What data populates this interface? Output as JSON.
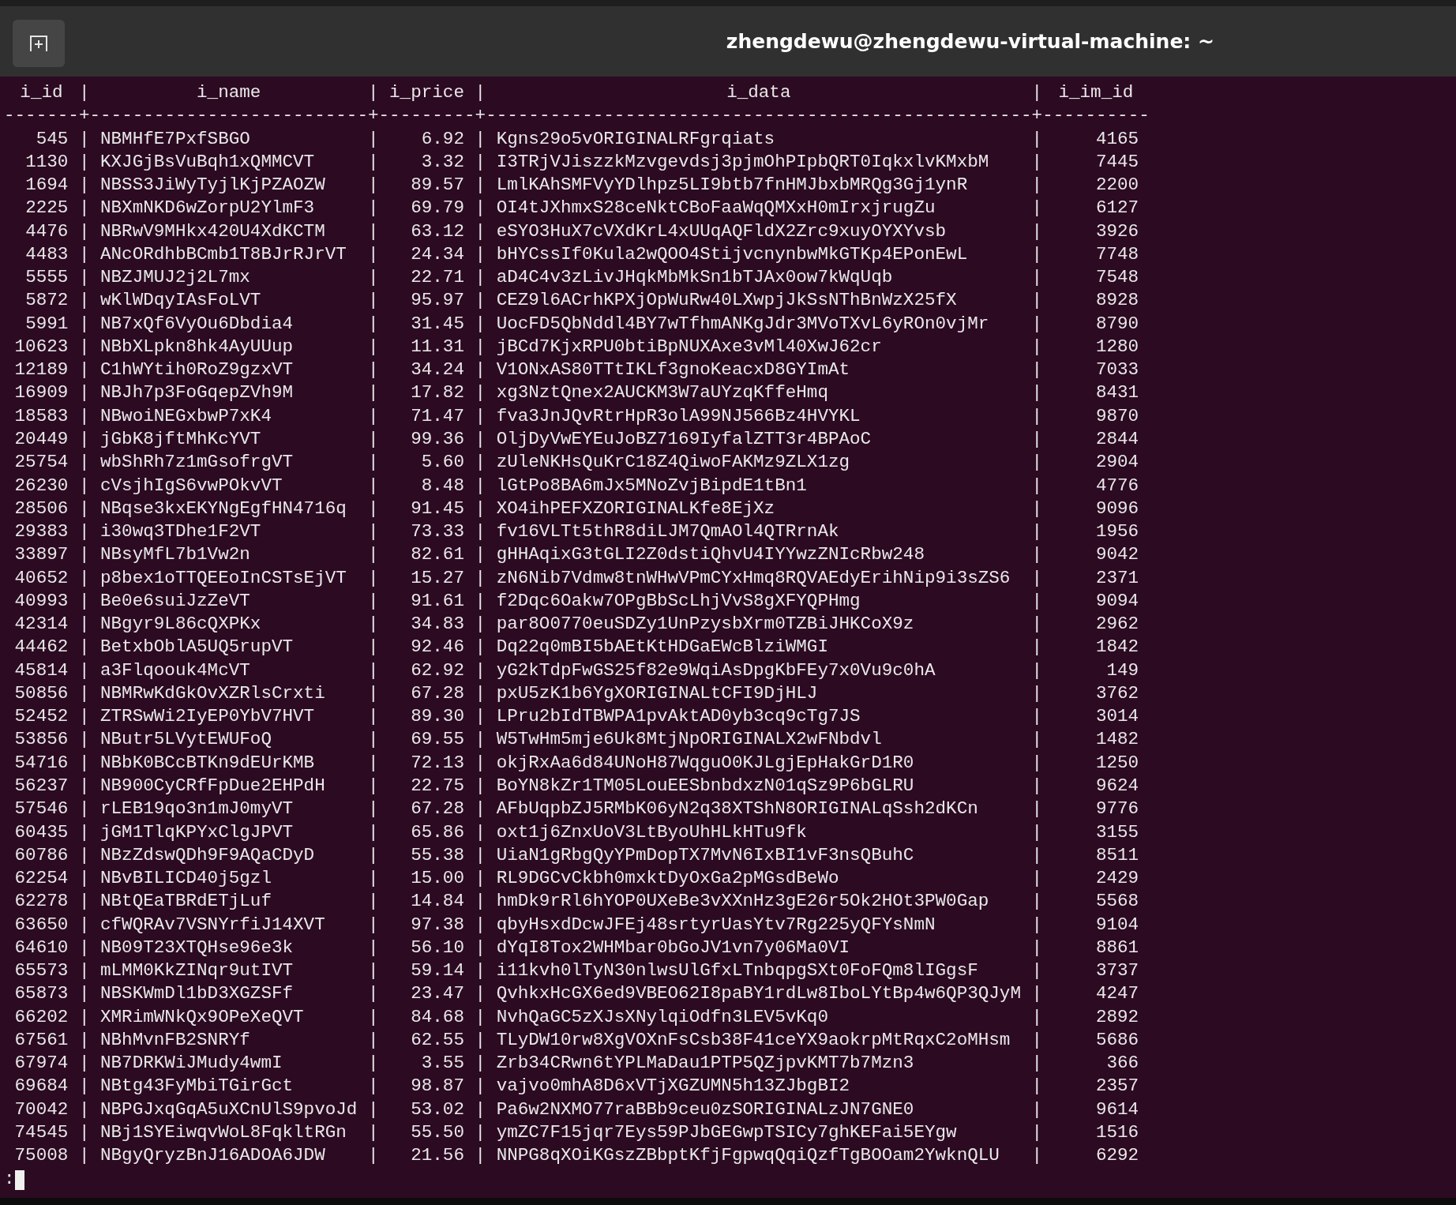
{
  "window": {
    "title": "zhengdewu@zhengdewu-virtual-machine: ~"
  },
  "table": {
    "columns": [
      "i_id",
      "i_name",
      "i_price",
      "i_data",
      "i_im_id"
    ],
    "separator": "|",
    "rule": "-------+--------------------------+---------+---------------------------------------------------+----------",
    "rows": [
      [
        "545",
        "NBMHfE7PxfSBGO",
        "6.92",
        "Kgns29o5vORIGINALRFgrqiats",
        "4165"
      ],
      [
        "1130",
        "KXJGjBsVuBqh1xQMMCVT",
        "3.32",
        "I3TRjVJiszzkMzvgevdsj3pjmOhPIpbQRT0IqkxlvKMxbM",
        "7445"
      ],
      [
        "1694",
        "NBSS3JiWyTyjlKjPZAOZW",
        "89.57",
        "LmlKAhSMFVyYDlhpz5LI9btb7fnHMJbxbMRQg3Gj1ynR",
        "2200"
      ],
      [
        "2225",
        "NBXmNKD6wZorpU2YlmF3",
        "69.79",
        "OI4tJXhmxS28ceNktCBoFaaWqQMXxH0mIrxjrugZu",
        "6127"
      ],
      [
        "4476",
        "NBRwV9MHkx420U4XdKCTM",
        "63.12",
        "eSYO3HuX7cVXdKrL4xUUqAQFldX2Zrc9xuyOYXYvsb",
        "3926"
      ],
      [
        "4483",
        "ANcORdhbBCmb1T8BJrRJrVT",
        "24.34",
        "bHYCssIf0Kula2wQOO4StijvcnynbwMkGTKp4EPonEwL",
        "7748"
      ],
      [
        "5555",
        "NBZJMUJ2j2L7mx",
        "22.71",
        "aD4C4v3zLivJHqkMbMkSn1bTJAx0ow7kWqUqb",
        "7548"
      ],
      [
        "5872",
        "wKlWDqyIAsFoLVT",
        "95.97",
        "CEZ9l6ACrhKPXjOpWuRw40LXwpjJkSsNThBnWzX25fX",
        "8928"
      ],
      [
        "5991",
        "NB7xQf6VyOu6Dbdia4",
        "31.45",
        "UocFD5QbNddl4BY7wTfhmANKgJdr3MVoTXvL6yROn0vjMr",
        "8790"
      ],
      [
        "10623",
        "NBbXLpkn8hk4AyUUup",
        "11.31",
        "jBCd7KjxRPU0btiBpNUXAxe3vMl40XwJ62cr",
        "1280"
      ],
      [
        "12189",
        "C1hWYtih0RoZ9gzxVT",
        "34.24",
        "V1ONxAS80TTtIKLf3gnoKeacxD8GYImAt",
        "7033"
      ],
      [
        "16909",
        "NBJh7p3FoGqepZVh9M",
        "17.82",
        "xg3NztQnex2AUCKM3W7aUYzqKffeHmq",
        "8431"
      ],
      [
        "18583",
        "NBwoiNEGxbwP7xK4",
        "71.47",
        "fva3JnJQvRtrHpR3olA99NJ566Bz4HVYKL",
        "9870"
      ],
      [
        "20449",
        "jGbK8jftMhKcYVT",
        "99.36",
        "OljDyVwEYEuJoBZ7169IyfalZTT3r4BPAoC",
        "2844"
      ],
      [
        "25754",
        "wbShRh7z1mGsofrgVT",
        "5.60",
        "zUleNKHsQuKrC18Z4QiwoFAKMz9ZLX1zg",
        "2904"
      ],
      [
        "26230",
        "cVsjhIgS6vwPOkvVT",
        "8.48",
        "lGtPo8BA6mJx5MNoZvjBipdE1tBn1",
        "4776"
      ],
      [
        "28506",
        "NBqse3kxEKYNgEgfHN4716q",
        "91.45",
        "XO4ihPEFXZORIGINALKfe8EjXz",
        "9096"
      ],
      [
        "29383",
        "i30wq3TDhe1F2VT",
        "73.33",
        "fv16VLTt5thR8diLJM7QmAOl4QTRrnAk",
        "1956"
      ],
      [
        "33897",
        "NBsyMfL7b1Vw2n",
        "82.61",
        "gHHAqixG3tGLI2Z0dstiQhvU4IYYwzZNIcRbw248",
        "9042"
      ],
      [
        "40652",
        "p8bex1oTTQEEoInCSTsEjVT",
        "15.27",
        "zN6Nib7Vdmw8tnWHwVPmCYxHmq8RQVAEdyErihNip9i3sZS6",
        "2371"
      ],
      [
        "40993",
        "Be0e6suiJzZeVT",
        "91.61",
        "f2Dqc6Oakw7OPgBbScLhjVvS8gXFYQPHmg",
        "9094"
      ],
      [
        "42314",
        "NBgyr9L86cQXPKx",
        "34.83",
        "par8O0770euSDZy1UnPzysbXrm0TZBiJHKCoX9z",
        "2962"
      ],
      [
        "44462",
        "BetxbOblA5UQ5rupVT",
        "92.46",
        "Dq22q0mBI5bAEtKtHDGaEWcBlziWMGI",
        "1842"
      ],
      [
        "45814",
        "a3Flqoouk4McVT",
        "62.92",
        "yG2kTdpFwGS25f82e9WqiAsDpgKbFEy7x0Vu9c0hA",
        "149"
      ],
      [
        "50856",
        "NBMRwKdGkOvXZRlsCrxti",
        "67.28",
        "pxU5zK1b6YgXORIGINALtCFI9DjHLJ",
        "3762"
      ],
      [
        "52452",
        "ZTRSwWi2IyEP0YbV7HVT",
        "89.30",
        "LPru2bIdTBWPA1pvAktAD0yb3cq9cTg7JS",
        "3014"
      ],
      [
        "53856",
        "NButr5LVytEWUFoQ",
        "69.55",
        "W5TwHm5mje6Uk8MtjNpORIGINALX2wFNbdvl",
        "1482"
      ],
      [
        "54716",
        "NBbK0BCcBTKn9dEUrKMB",
        "72.13",
        "okjRxAa6d84UNoH87WqguO0KJLgjEpHakGrD1R0",
        "1250"
      ],
      [
        "56237",
        "NB900CyCRfFpDue2EHPdH",
        "22.75",
        "BoYN8kZr1TM05LouEESbnbdxzN01qSz9P6bGLRU",
        "9624"
      ],
      [
        "57546",
        "rLEB19qo3n1mJ0myVT",
        "67.28",
        "AFbUqpbZJ5RMbK06yN2q38XTShN8ORIGINALqSsh2dKCn",
        "9776"
      ],
      [
        "60435",
        "jGM1TlqKPYxClgJPVT",
        "65.86",
        "oxt1j6ZnxUoV3LtByoUhHLkHTu9fk",
        "3155"
      ],
      [
        "60786",
        "NBzZdswQDh9F9AQaCDyD",
        "55.38",
        "UiaN1gRbgQyYPmDopTX7MvN6IxBI1vF3nsQBuhC",
        "8511"
      ],
      [
        "62254",
        "NBvBILICD40j5gzl",
        "15.00",
        "RL9DGCvCkbh0mxktDyOxGa2pMGsdBeWo",
        "2429"
      ],
      [
        "62278",
        "NBtQEaTBRdETjLuf",
        "14.84",
        "hmDk9rRl6hYOP0UXeBe3vXXnHz3gE26r5Ok2HOt3PW0Gap",
        "5568"
      ],
      [
        "63650",
        "cfWQRAv7VSNYrfiJ14XVT",
        "97.38",
        "qbyHsxdDcwJFEj48srtyrUasYtv7Rg225yQFYsNmN",
        "9104"
      ],
      [
        "64610",
        "NB09T23XTQHse96e3k",
        "56.10",
        "dYqI8Tox2WHMbar0bGoJV1vn7y06Ma0VI",
        "8861"
      ],
      [
        "65573",
        "mLMM0KkZINqr9utIVT",
        "59.14",
        "i11kvh0lTyN30nlwsUlGfxLTnbqpgSXt0FoFQm8lIGgsF",
        "3737"
      ],
      [
        "65873",
        "NBSKWmDl1bD3XGZSFf",
        "23.47",
        "QvhkxHcGX6ed9VBEO62I8paBY1rdLw8IboLYtBp4w6QP3QJyM",
        "4247"
      ],
      [
        "66202",
        "XMRimWNkQx9OPeXeQVT",
        "84.68",
        "NvhQaGC5zXJsXNylqiOdfn3LEV5vKq0",
        "2892"
      ],
      [
        "67561",
        "NBhMvnFB2SNRYf",
        "62.55",
        "TLyDW10rw8XgVOXnFsCsb38F41ceYX9aokrpMtRqxC2oMHsm",
        "5686"
      ],
      [
        "67974",
        "NB7DRKWiJMudy4wmI",
        "3.55",
        "Zrb34CRwn6tYPLMaDau1PTP5QZjpvKMT7b7Mzn3",
        "366"
      ],
      [
        "69684",
        "NBtg43FyMbiTGirGct",
        "98.87",
        "vajvo0mhA8D6xVTjXGZUMN5h13ZJbgBI2",
        "2357"
      ],
      [
        "70042",
        "NBPGJxqGqA5uXCnUlS9pvoJd",
        "53.02",
        "Pa6w2NXMO77raBBb9ceu0zSORIGINALzJN7GNE0",
        "9614"
      ],
      [
        "74545",
        "NBj1SYEiwqvWoL8FqkltRGn",
        "55.50",
        "ymZC7F15jqr7Eys59PJbGEGwpTSICy7ghKEFai5EYgw",
        "1516"
      ],
      [
        "75008",
        "NBgyQryzBnJ16ADOA6JDW",
        "21.56",
        "NNPG8qXOiKGszZBbptKfjFgpwqQqiQzfTgBOOam2YwknQLU",
        "6292"
      ]
    ]
  },
  "prompt": ":"
}
